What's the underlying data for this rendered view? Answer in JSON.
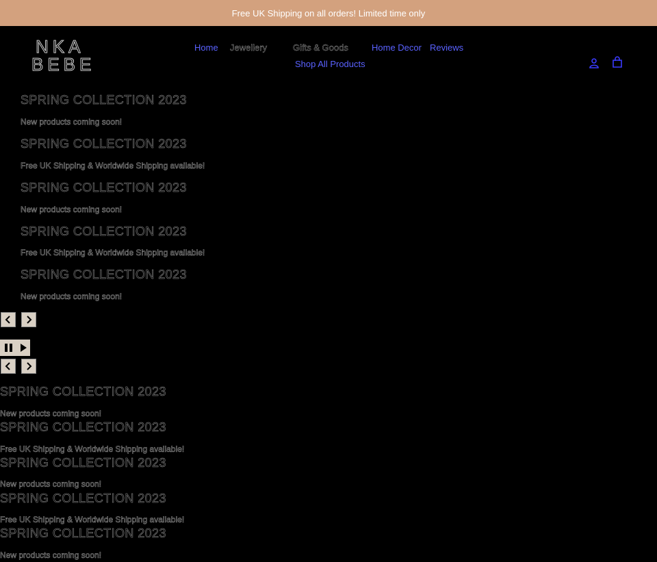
{
  "announcement": "Free UK Shipping on all orders! Limited time only",
  "logo": {
    "line1": "NKA",
    "line2": "BEBE"
  },
  "nav": {
    "home": "Home",
    "jewellery": "Jewellery",
    "gifts": "Gifts & Goods",
    "home_decor": "Home Decor",
    "reviews": "Reviews",
    "shop_all": "Shop All Products"
  },
  "icons": {
    "account": "user-icon",
    "cart": "bag-icon"
  },
  "colors": {
    "announcement_bg": "#d3a17e",
    "link": "#5a62ff",
    "page_bg": "#000000",
    "control_bg": "#d9d0c4"
  },
  "slideshow_1": {
    "slides": [
      {
        "heading": "SPRING COLLECTION 2023",
        "text": "New products coming soon!"
      },
      {
        "heading": "SPRING COLLECTION 2023",
        "text": "Free UK Shipping & Worldwide Shipping available!"
      },
      {
        "heading": "SPRING COLLECTION 2023",
        "text": "New products coming soon!"
      },
      {
        "heading": "SPRING COLLECTION 2023",
        "text": "Free UK Shipping & Worldwide Shipping available!"
      },
      {
        "heading": "SPRING COLLECTION 2023",
        "text": "New products coming soon!"
      }
    ]
  },
  "slideshow_2": {
    "slides": [
      {
        "heading": "SPRING COLLECTION 2023",
        "text": "New products coming soon!"
      },
      {
        "heading": "SPRING COLLECTION 2023",
        "text": "Free UK Shipping & Worldwide Shipping available!"
      },
      {
        "heading": "SPRING COLLECTION 2023",
        "text": "New products coming soon!"
      },
      {
        "heading": "SPRING COLLECTION 2023",
        "text": "Free UK Shipping & Worldwide Shipping available!"
      },
      {
        "heading": "SPRING COLLECTION 2023",
        "text": "New products coming soon!"
      }
    ]
  }
}
